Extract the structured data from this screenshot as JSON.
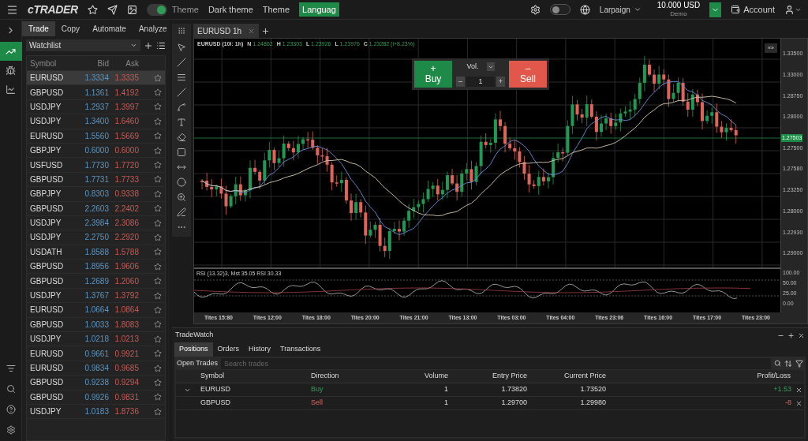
{
  "top_bar": {
    "logo": "cTRADER",
    "theme_toggle_on": true,
    "theme_label": "Theme",
    "links": [
      "Dark theme",
      "Theme"
    ],
    "language_button": "Languag",
    "settings_toggle_on": false,
    "account_selector": "Larpaign",
    "balance": "10.000 USD",
    "account_type": "Demo",
    "account_label": "Account"
  },
  "side_rail": {
    "items": [
      {
        "kind": "trade",
        "selected": true
      },
      {
        "kind": "copy",
        "selected": false
      },
      {
        "kind": "analyze",
        "selected": false
      }
    ]
  },
  "panel_tabs": [
    {
      "label": "Trade",
      "selected": true
    },
    {
      "label": "Copy",
      "selected": false
    },
    {
      "label": "Automate",
      "selected": false
    },
    {
      "label": "Analyze",
      "selected": false
    }
  ],
  "watchlist": {
    "name": "Watchlist",
    "columns": [
      "Symbol",
      "Bid",
      "Ask"
    ],
    "rows": [
      {
        "symbol": "EURUSD",
        "bid": "1.3334",
        "ask": "1.3335",
        "selected": true
      },
      {
        "symbol": "GBPUSD",
        "bid": "1.1361",
        "ask": "1.4192",
        "selected": false
      },
      {
        "symbol": "USDJPY",
        "bid": "1.2937",
        "ask": "1.3997",
        "selected": false
      },
      {
        "symbol": "USDJPY",
        "bid": "1.3400",
        "ask": "1.6460",
        "selected": false
      },
      {
        "symbol": "EURUSD",
        "bid": "1.5560",
        "ask": "1.5669",
        "selected": false
      },
      {
        "symbol": "GBPJPY",
        "bid": "0.6000",
        "ask": "0.6000",
        "selected": false
      },
      {
        "symbol": "USFUSD",
        "bid": "1.7730",
        "ask": "1.7720",
        "selected": false
      },
      {
        "symbol": "GBPUSD",
        "bid": "1.7731",
        "ask": "1.7733",
        "selected": false
      },
      {
        "symbol": "GBPJPY",
        "bid": "0.8303",
        "ask": "0.9338",
        "selected": false
      },
      {
        "symbol": "GBPUSD",
        "bid": "2.2603",
        "ask": "2.2402",
        "selected": false
      },
      {
        "symbol": "USDJPY",
        "bid": "2.3984",
        "ask": "2.3086",
        "selected": false
      },
      {
        "symbol": "USDJPY",
        "bid": "2.2750",
        "ask": "2.2920",
        "selected": false
      },
      {
        "symbol": "USDATH",
        "bid": "1.8588",
        "ask": "1.5788",
        "selected": false
      },
      {
        "symbol": "GBPUSD",
        "bid": "1.8956",
        "ask": "1.9606",
        "selected": false
      },
      {
        "symbol": "GBPUSD",
        "bid": "1.2689",
        "ask": "1.2060",
        "selected": false
      },
      {
        "symbol": "USDJPY",
        "bid": "1.3767",
        "ask": "1.3792",
        "selected": false
      },
      {
        "symbol": "EURUSD",
        "bid": "1.0664",
        "ask": "1.0864",
        "selected": false
      },
      {
        "symbol": "GBPUSD",
        "bid": "1.0033",
        "ask": "1.8083",
        "selected": false
      },
      {
        "symbol": "USDJPY",
        "bid": "1.0218",
        "ask": "1.0213",
        "selected": false
      },
      {
        "symbol": "EURUSD",
        "bid": "0.9661",
        "ask": "0.9921",
        "selected": false
      },
      {
        "symbol": "EURUSD",
        "bid": "0.9834",
        "ask": "0.9685",
        "selected": false
      },
      {
        "symbol": "GBPUSD",
        "bid": "0.9238",
        "ask": "0.9294",
        "selected": false
      },
      {
        "symbol": "GBPUSD",
        "bid": "0.9926",
        "ask": "0.9831",
        "selected": false
      },
      {
        "symbol": "USDJPY",
        "bid": "1.0183",
        "ask": "1.8736",
        "selected": false
      }
    ]
  },
  "chart_tabs": [
    {
      "label": "EURUSD 1h",
      "selected": true
    }
  ],
  "chart": {
    "symbol": "EURUSD (10i: 1h)",
    "quotes": [
      {
        "key": "N",
        "value": "1.24862"
      },
      {
        "key": "H",
        "value": "1.23303"
      },
      {
        "key": "L",
        "value": "1.23926"
      },
      {
        "key": "L",
        "value": "1.23976"
      },
      {
        "key": "C",
        "value": "1.23282 (i+8.23%)"
      }
    ],
    "trade_widget": {
      "buy_sign": "+",
      "buy": "Buy",
      "sell_sign": "–",
      "sell": "Sell",
      "volume_label": "Vol.",
      "volume": "1",
      "minus": "–",
      "plus": "+"
    },
    "collapse_button": "«»",
    "price_ticks": [
      "1.33500",
      "1.33000",
      "1.28750",
      "1.28000",
      "1.27500",
      "1.27580",
      "1.23250",
      "1.28000",
      "1.22930",
      "1.29000"
    ],
    "current_price": "1.27503",
    "indicator_label": "RSI (13.32)3, Mst 35.05 RSI 30.33",
    "indicator_ticks": [
      "100.00",
      "50.00",
      "25.00",
      "0.00"
    ],
    "time_ticks": [
      "Tites 15:80",
      "Tites 12:00",
      "Tites 18:00",
      "Tites 20:00",
      "Tites 21:00",
      "Tites 13:00",
      "Tites 03:00",
      "Tites 04:00",
      "Tites 23:06",
      "Tites 16:00",
      "Tites 17:00",
      "Tites 23:00"
    ]
  },
  "trade_watch": {
    "title": "TradeWatch",
    "tabs": [
      {
        "label": "Positions",
        "selected": true
      },
      {
        "label": "Orders",
        "selected": false
      },
      {
        "label": "History",
        "selected": false
      },
      {
        "label": "Transactions",
        "selected": false
      }
    ],
    "filter_label": "Open Trades",
    "search": {
      "placeholder": "Search trades"
    },
    "columns": [
      "Symbol",
      "Direction",
      "Volume",
      "Entry Price",
      "Current Price",
      "Profit/Loss"
    ],
    "rows": [
      {
        "symbol": "EURUSD",
        "direction": "Buy",
        "kind": "buy",
        "volume": "1",
        "entry": "1.73820",
        "current": "1.73520",
        "profit": "+1.53",
        "expanded": false
      },
      {
        "symbol": "GBPUSD",
        "direction": "Sell",
        "kind": "sell",
        "volume": "1",
        "entry": "1.29700",
        "current": "1.29980",
        "profit": "-8",
        "expanded": null
      }
    ]
  }
}
